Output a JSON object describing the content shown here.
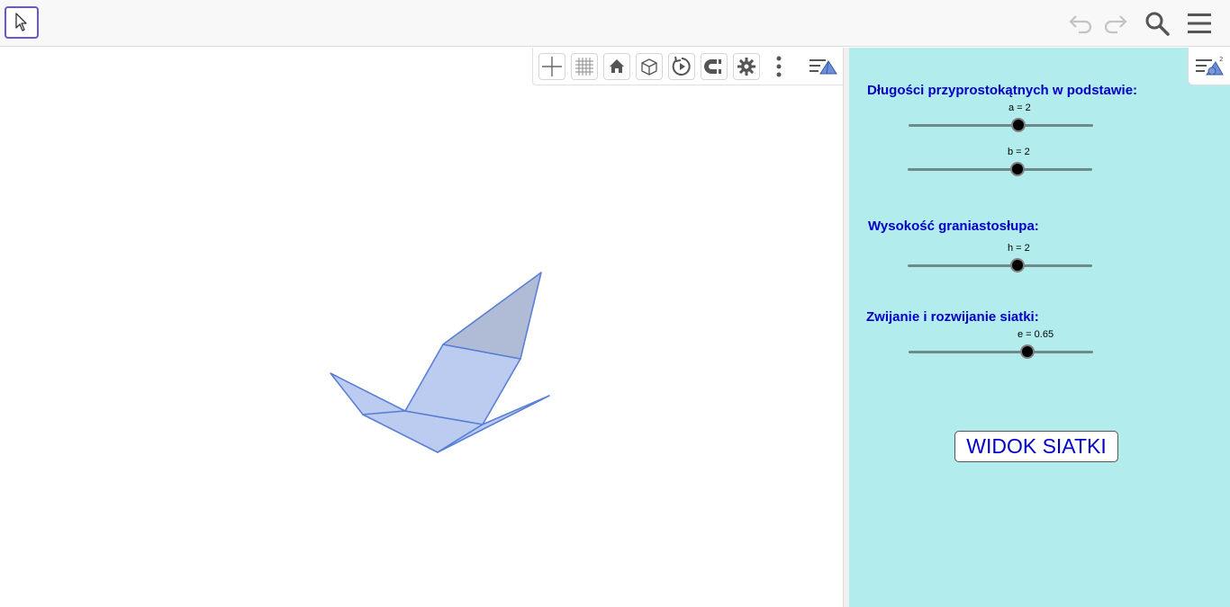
{
  "toolbar": {
    "move_tool": "move-tool",
    "undo": "undo",
    "redo": "redo",
    "search": "search",
    "menu": "menu"
  },
  "graphics_toolbar": {
    "buttons": [
      "axes",
      "grid",
      "home",
      "view-in-front",
      "rotate",
      "point-capturing",
      "settings",
      "more",
      "style-bar-toggle"
    ]
  },
  "panel": {
    "heading_legs": "Długości przyprostokątnych w podstawie:",
    "slider_a": {
      "label": "a = 2",
      "value": 2
    },
    "slider_b": {
      "label": "b = 2",
      "value": 2
    },
    "heading_height": "Wysokość graniastosłupa:",
    "slider_h": {
      "label": "h = 2",
      "value": 2
    },
    "heading_fold": "Zwijanie i rozwijanie siatki:",
    "slider_e": {
      "label": "e = 0.65",
      "value": 0.65
    },
    "net_button": "WIDOK SIATKI"
  },
  "colors": {
    "panel_bg": "#b2ecec",
    "heading": "#0000c8",
    "prism_face": "#bcccf0",
    "prism_top": "#b0bcd6",
    "prism_edge": "#5a7fd6",
    "accent": "#6557d2"
  }
}
